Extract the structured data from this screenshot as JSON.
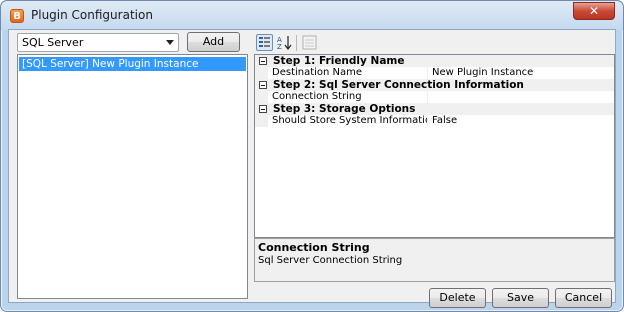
{
  "window": {
    "title": "Plugin Configuration",
    "app_icon_glyph": "B",
    "close_glyph": "✕"
  },
  "left_panel": {
    "plugin_type_select": {
      "value": "SQL Server"
    },
    "add_label": "Add",
    "instances": [
      {
        "label": "[SQL Server] New Plugin Instance",
        "selected": true
      }
    ]
  },
  "toolbar": {
    "icons": [
      "categorized-view-icon",
      "alphabetical-sort-icon",
      "property-pages-icon"
    ]
  },
  "property_grid": {
    "categories": [
      {
        "title": "Step 1: Friendly Name",
        "properties": [
          {
            "name": "Destination Name",
            "value": "New Plugin Instance"
          }
        ]
      },
      {
        "title": "Step 2: Sql Server Connection Information",
        "properties": [
          {
            "name": "Connection String",
            "value": ""
          }
        ]
      },
      {
        "title": "Step 3: Storage Options",
        "properties": [
          {
            "name": "Should Store System Information",
            "value": "False"
          }
        ]
      }
    ]
  },
  "description": {
    "title": "Connection String",
    "text": "Sql Server Connection String"
  },
  "footer": {
    "delete_label": "Delete",
    "save_label": "Save",
    "cancel_label": "Cancel"
  },
  "colors": {
    "selection": "#3399ff",
    "window_frame": "#bcd3ec",
    "close_button": "#c94a36"
  }
}
